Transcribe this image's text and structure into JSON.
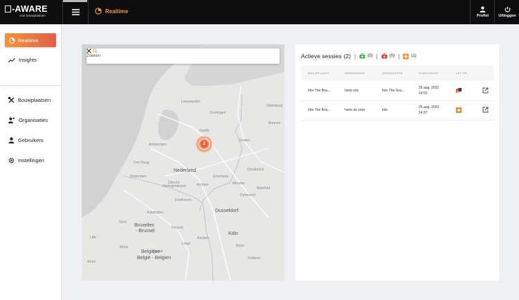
{
  "header": {
    "logo_main": "-AWARE",
    "logo_sub": "voor bouwplaatsen",
    "page_title": "Realtime",
    "profile_label": "Profiel",
    "logout_label": "Uitloggen"
  },
  "sidebar": {
    "items": [
      {
        "label": "Realtime",
        "icon": "radio-icon",
        "active": true
      },
      {
        "label": "Insights",
        "icon": "trend-icon"
      },
      {
        "label": "Bouwplaatsen",
        "icon": "tools-icon"
      },
      {
        "label": "Organisaties",
        "icon": "org-icon"
      },
      {
        "label": "Gebruikers",
        "icon": "user-icon"
      },
      {
        "label": "Instellingen",
        "icon": "gear-icon"
      }
    ]
  },
  "map": {
    "search_placeholder": "Zoeken",
    "cluster_count": "2",
    "labels": {
      "leeuwarden": "Leeuwarden",
      "groningen": "Groningen",
      "oldenburg": "Oldenburg",
      "nederland": "Nederland",
      "bremen": "Bremen",
      "amsterdam": "Amsterdam",
      "hertogenbosch": "Hertogenbosch",
      "eindhoven": "Eindhoven",
      "antwerpen": "Antwerpen",
      "dortmund": "Dortmund",
      "dusseldorf": "Dusseldorf",
      "brussel1": "Bruxelles",
      "brussel2": "- Brussel",
      "hasselt": "Hasselt",
      "liege": "Liège",
      "aachen": "Aachen",
      "koln": "Köln",
      "belgique": "Belgique -",
      "belgie": "België - Belgien",
      "ghent": "Gent",
      "mons": "Mons",
      "koblenz": "Koblenz",
      "munster": "Münster",
      "osnabruck": "Osnabrück",
      "emden": "Emden",
      "arras": "Arras",
      "lille": "Lille",
      "namur": "Namur",
      "bonn": "Bonn",
      "enschede": "Enschede",
      "zwolle": "Zwolle",
      "den_haag": "Den Haag",
      "rotterdam": "Rotterdam",
      "utrecht": "Utrecht",
      "arnhem": "Arnhem",
      "bielefeld": "Bielefeld"
    }
  },
  "sessions": {
    "title": "Actieve sessies",
    "count": "(2)",
    "sep": "|",
    "badge1_count": "(0)",
    "badge2_count": "(0)",
    "badge3_count": "(1)",
    "colors": {
      "green": "#4caf50",
      "red": "#e53935",
      "orange": "#f5812a"
    },
    "columns": [
      "BOUWPLAATS",
      "WERKNEMER",
      "ORGANISATIE",
      "INGECHECKT",
      "LET OP"
    ],
    "rows": [
      {
        "bouwplaats": "Into The Bou...",
        "werknemer": "henk vos",
        "organisatie": "Into The Sou...",
        "date": "26 aug. 2022",
        "time": "14:52",
        "let_op": "medal-icon"
      },
      {
        "bouwplaats": "Into The Bou...",
        "werknemer": "henk de vries",
        "organisatie": "into",
        "date": "26 aug. 2022",
        "time": "14:37",
        "let_op": "firstaid-icon"
      }
    ]
  }
}
